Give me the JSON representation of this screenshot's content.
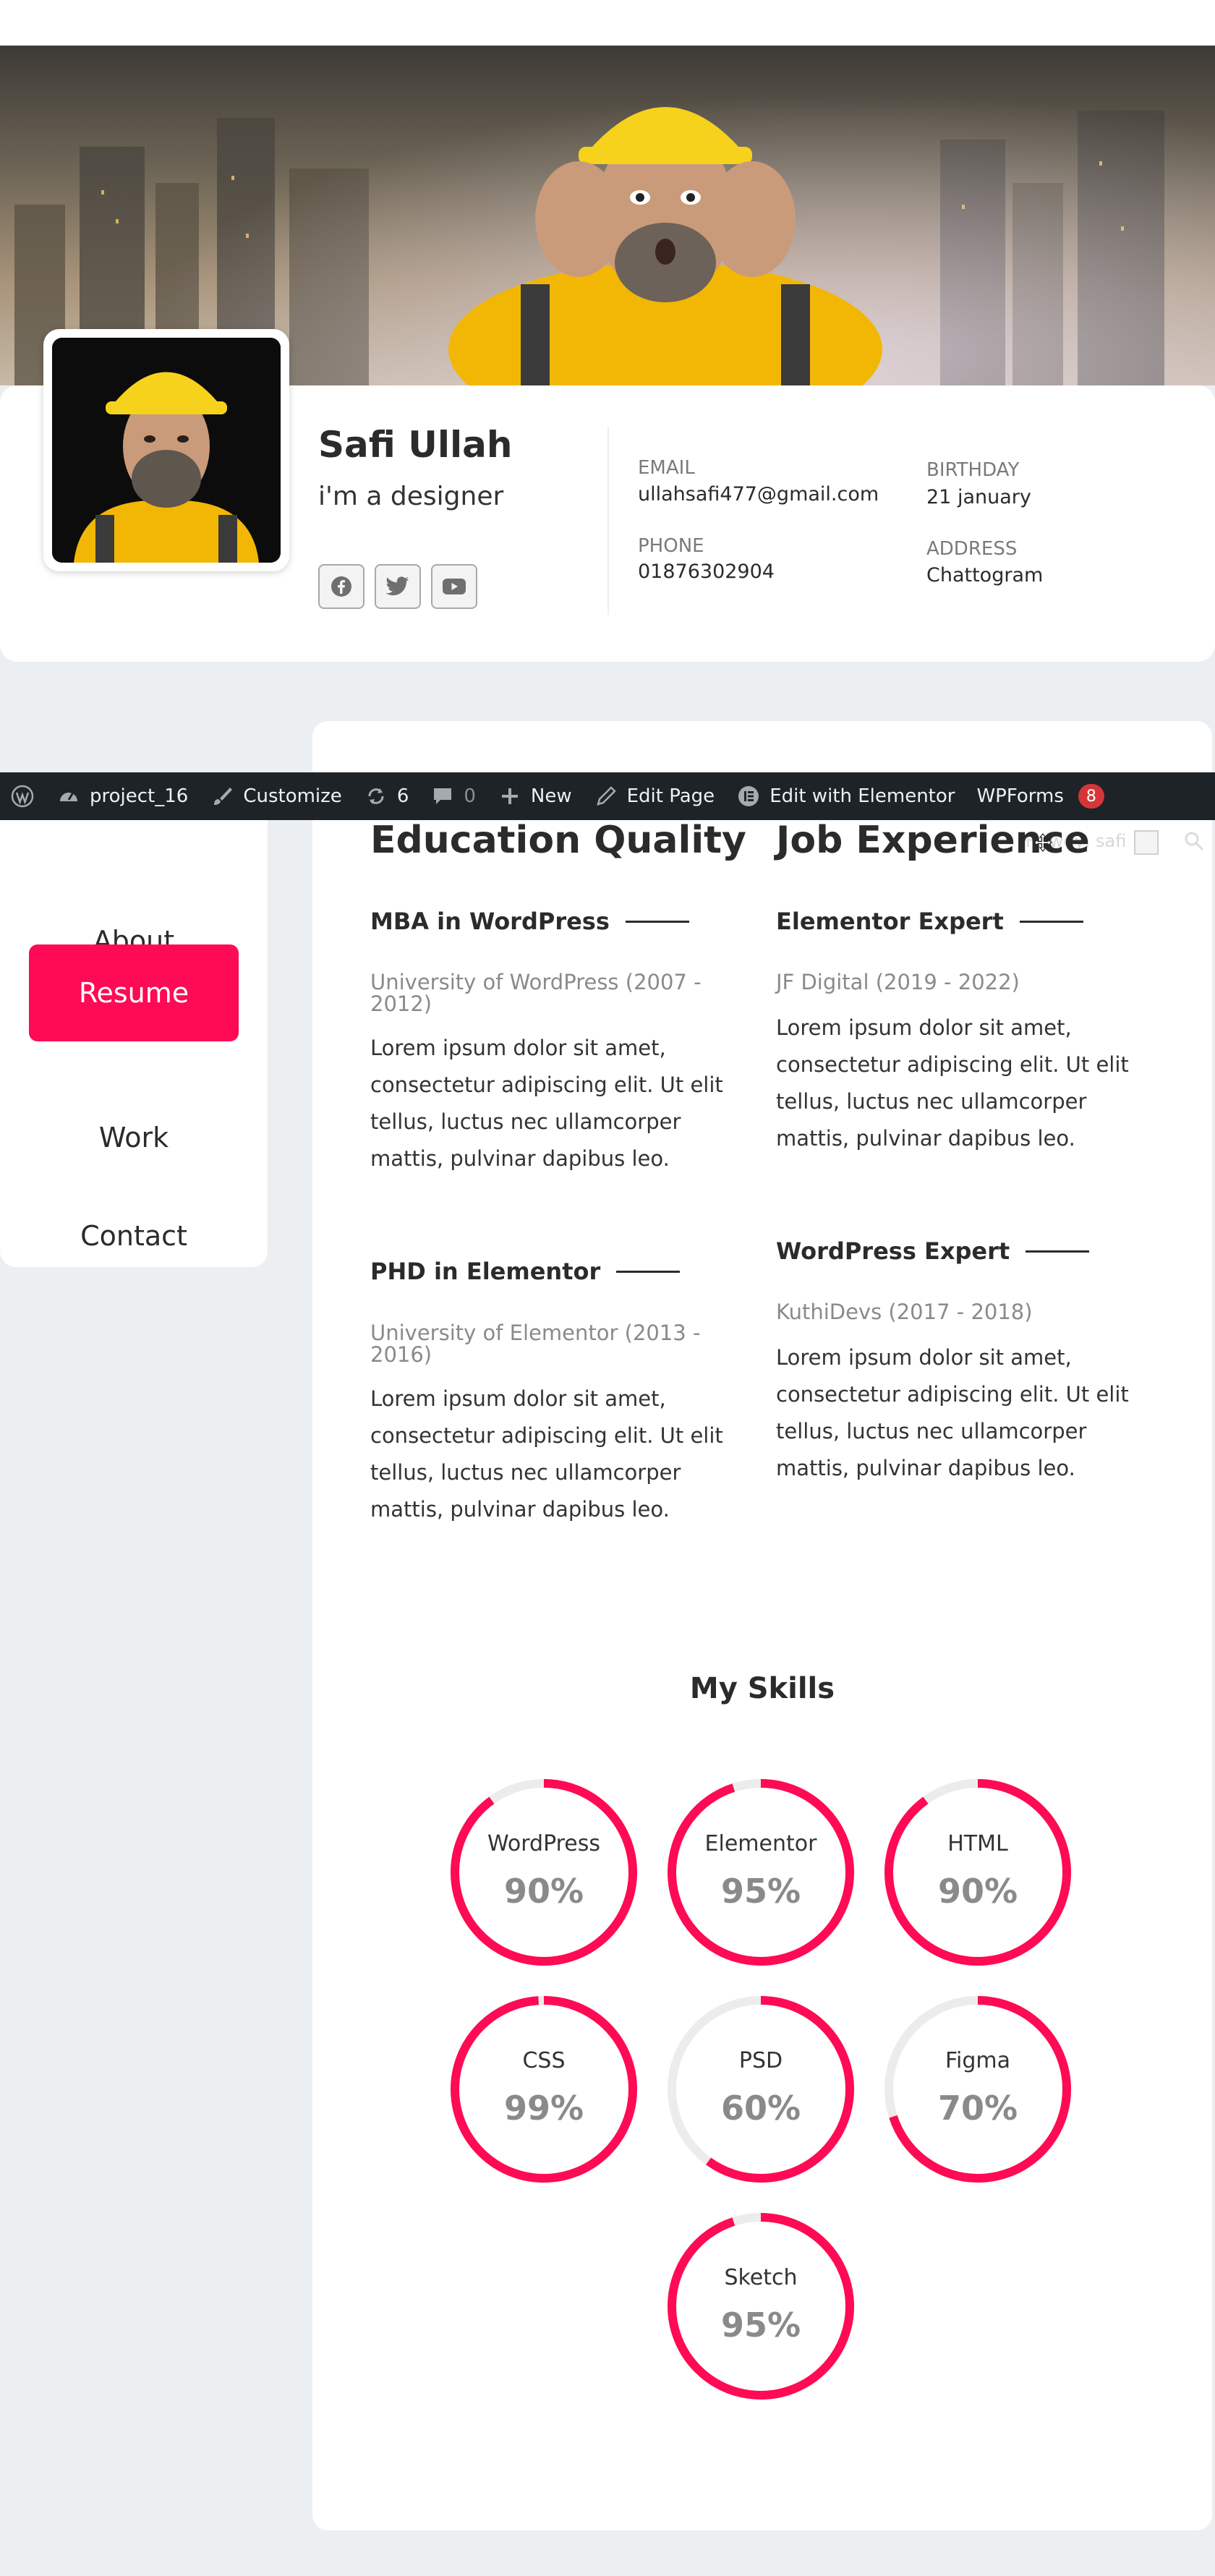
{
  "profile": {
    "name": "Safi Ullah",
    "role": "i'm a designer",
    "socials": [
      {
        "icon": "facebook-icon"
      },
      {
        "icon": "twitter-icon"
      },
      {
        "icon": "youtube-icon"
      }
    ],
    "info": {
      "email_label": "EMAIL",
      "email": "ullahsafi477@gmail.com",
      "phone_label": "PHONE",
      "phone": "01876302904",
      "birthday_label": "BIRTHDAY",
      "birthday": "21 january",
      "address_label": "ADDRESS",
      "address": "Chattogram"
    }
  },
  "adminbar": {
    "site": "project_16",
    "customize": "Customize",
    "updates": "6",
    "comments": "0",
    "new": "New",
    "edit_page": "Edit Page",
    "edit_elementor": "Edit with Elementor",
    "wpforms": "WPForms",
    "wpforms_count": "8",
    "howdy": "Howdy, safi"
  },
  "nav": {
    "items": [
      {
        "label": "About",
        "active": false
      },
      {
        "label": "Resume",
        "active": true
      },
      {
        "label": "Work",
        "active": false
      },
      {
        "label": "Contact",
        "active": false
      }
    ]
  },
  "education": {
    "title": "Education Quality",
    "items": [
      {
        "title": "MBA in WordPress",
        "meta": "University of WordPress (2007 - 2012)",
        "desc": "Lorem ipsum dolor sit amet, consectetur adipiscing elit. Ut elit tellus, luctus nec ullamcorper mattis, pulvinar dapibus leo."
      },
      {
        "title": "PHD in Elementor",
        "meta": "University of Elementor (2013 - 2016)",
        "desc": "Lorem ipsum dolor sit amet, consectetur adipiscing elit. Ut elit tellus, luctus nec ullamcorper mattis, pulvinar dapibus leo."
      }
    ]
  },
  "experience": {
    "title": "Job Experience",
    "items": [
      {
        "title": "Elementor Expert",
        "meta": "JF Digital (2019 - 2022)",
        "desc": "Lorem ipsum dolor sit amet, consectetur adipiscing elit. Ut elit tellus, luctus nec ullamcorper mattis, pulvinar dapibus leo."
      },
      {
        "title": "WordPress Expert",
        "meta": "KuthiDevs (2017 - 2018)",
        "desc": "Lorem ipsum dolor sit amet, consectetur adipiscing elit. Ut elit tellus, luctus nec ullamcorper mattis, pulvinar dapibus leo."
      }
    ]
  },
  "skills": {
    "title": "My Skills",
    "items": [
      {
        "name": "WordPress",
        "percent": 90,
        "label": "90%"
      },
      {
        "name": "Elementor",
        "percent": 95,
        "label": "95%"
      },
      {
        "name": "HTML",
        "percent": 90,
        "label": "90%"
      },
      {
        "name": "CSS",
        "percent": 99,
        "label": "99%"
      },
      {
        "name": "PSD",
        "percent": 60,
        "label": "60%"
      },
      {
        "name": "Figma",
        "percent": 70,
        "label": "70%"
      },
      {
        "name": "Sketch",
        "percent": 95,
        "label": "95%"
      }
    ]
  },
  "colors": {
    "accent": "#ff0a54",
    "track": "#ececec",
    "adminbar": "#1d2327"
  }
}
